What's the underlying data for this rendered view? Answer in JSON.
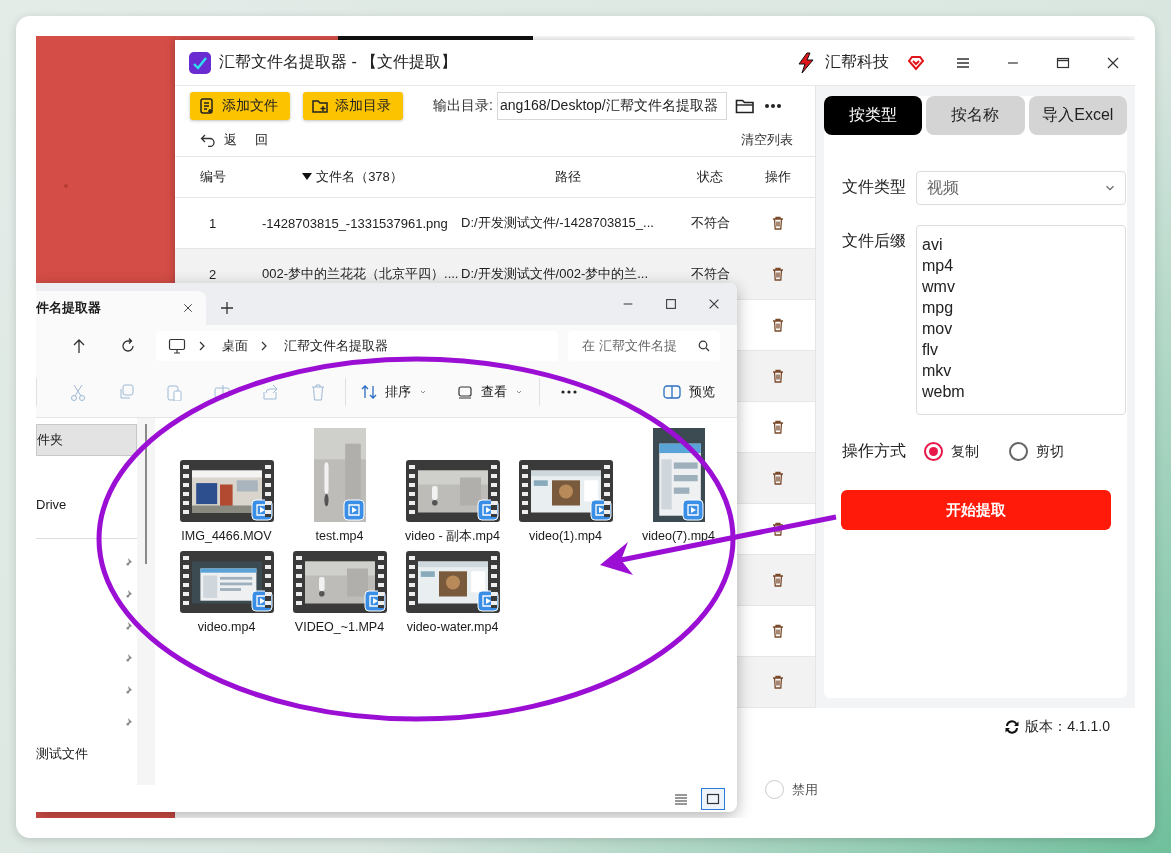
{
  "app": {
    "title": "汇帮文件名提取器 - 【文件提取】",
    "brand": "汇帮科技",
    "toolbar": {
      "buttons": [
        "添加文件",
        "添加目录"
      ],
      "output_label": "输出目录:",
      "output_path": "ang168/Desktop/汇帮文件名提取器"
    },
    "back": "返 回",
    "clear": "清空列表",
    "table": {
      "columns": [
        {
          "label": "编号",
          "sorted": false
        },
        {
          "label": "文件名（378）",
          "sorted": true
        },
        {
          "label": "路径",
          "sorted": false
        },
        {
          "label": "状态",
          "sorted": false
        },
        {
          "label": "操作",
          "sorted": false
        }
      ],
      "rows": [
        {
          "kind": "full",
          "number": "1",
          "name": "-1428703815_-1331537961.png",
          "path": "D:/开发测试文件/-1428703815_...",
          "status": "不符合"
        },
        {
          "kind": "full",
          "number": "2",
          "name": "002-梦中的兰花花（北京平四）....",
          "path": "D:/开发测试文件/002-梦中的兰...",
          "status": "不符合"
        },
        {
          "kind": "covered"
        },
        {
          "kind": "covered"
        },
        {
          "kind": "covered"
        },
        {
          "kind": "covered"
        },
        {
          "kind": "covered"
        },
        {
          "kind": "covered"
        },
        {
          "kind": "covered"
        },
        {
          "kind": "covered"
        }
      ]
    },
    "panel": {
      "tabs": [
        {
          "label": "按类型",
          "selected": true
        },
        {
          "label": "按名称",
          "selected": false
        },
        {
          "label": "导入Excel",
          "selected": false
        }
      ],
      "type_label": "文件类型",
      "type_value": "视频",
      "suffix_label": "文件后缀",
      "suffixes": [
        "avi",
        "mp4",
        "wmv",
        "mpg",
        "mov",
        "flv",
        "mkv",
        "webm"
      ],
      "mode_label": "操作方式",
      "modes": [
        {
          "label": "复制",
          "selected": true
        },
        {
          "label": "剪切",
          "selected": false
        }
      ],
      "start": "开始提取"
    },
    "version": "版本：4.1.1.0",
    "extra_option": {
      "label": "禁用",
      "selected": false
    }
  },
  "explorer": {
    "tab": "件名提取器",
    "breadcrumb": [
      "桌面",
      "汇帮文件名提取器"
    ],
    "search_placeholder": "在 汇帮文件名提",
    "commands": [
      "排序",
      "查看"
    ],
    "preview": "预览",
    "sidebar": [
      {
        "label": "件夹",
        "selected": true
      },
      {
        "label": "Drive",
        "selected": false
      }
    ],
    "quick_access": [
      {
        "pinned": true
      },
      {
        "pinned": true
      },
      {
        "pinned": true
      },
      {
        "pinned": true
      },
      {
        "pinned": true
      },
      {
        "pinned": true
      }
    ],
    "last_item": "测试文件",
    "files": [
      {
        "name": "IMG_4466.MOV",
        "kind": "landscape"
      },
      {
        "name": "test.mp4",
        "kind": "portrait"
      },
      {
        "name": "video - 副本.mp4",
        "kind": "landscape"
      },
      {
        "name": "video(1).mp4",
        "kind": "landscape"
      },
      {
        "name": "video(7).mp4",
        "kind": "portrait"
      },
      {
        "name": "video.mp4",
        "kind": "landscape"
      },
      {
        "name": "VIDEO_~1.MP4",
        "kind": "landscape"
      },
      {
        "name": "video-water.mp4",
        "kind": "landscape"
      }
    ],
    "views": [
      {
        "kind": "details",
        "selected": false
      },
      {
        "kind": "tiles",
        "selected": true
      }
    ]
  }
}
